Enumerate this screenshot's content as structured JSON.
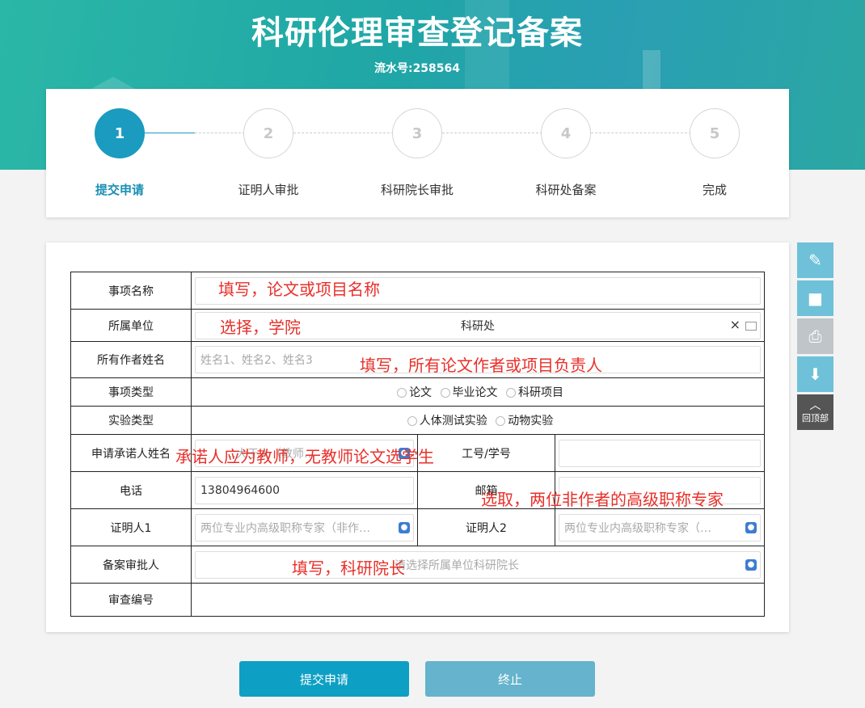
{
  "header": {
    "title": "科研伦理审查登记备案",
    "serial": "流水号:258564"
  },
  "steps": [
    {
      "num": "1",
      "label": "提交申请",
      "active": true
    },
    {
      "num": "2",
      "label": "证明人审批",
      "active": false
    },
    {
      "num": "3",
      "label": "科研院长审批",
      "active": false
    },
    {
      "num": "4",
      "label": "科研处备案",
      "active": false
    },
    {
      "num": "5",
      "label": "完成",
      "active": false
    }
  ],
  "form": {
    "item_name": {
      "label": "事项名称",
      "value": ""
    },
    "unit": {
      "label": "所属单位",
      "value": "科研处",
      "clear": "×"
    },
    "authors": {
      "label": "所有作者姓名",
      "placeholder": "姓名1、姓名2、姓名3"
    },
    "item_type": {
      "label": "事项类型",
      "options": [
        "论文",
        "毕业论文",
        "科研项目"
      ]
    },
    "exp_type": {
      "label": "实验类型",
      "options": [
        "人体测试实验",
        "动物实验"
      ]
    },
    "applicant": {
      "label": "申请承诺人姓名",
      "placeholder": "…大于人（教师…"
    },
    "staff_id": {
      "label": "工号/学号",
      "value": ""
    },
    "phone": {
      "label": "电话",
      "value": "13804964600"
    },
    "email": {
      "label": "邮箱",
      "value": ""
    },
    "witness1": {
      "label": "证明人1",
      "placeholder": "两位专业内高级职称专家（非作…"
    },
    "witness2": {
      "label": "证明人2",
      "placeholder": "两位专业内高级职称专家（…"
    },
    "approver": {
      "label": "备案审批人",
      "placeholder": "请选择所属单位科研院长"
    },
    "review_no": {
      "label": "审查编号",
      "value": ""
    }
  },
  "annotations": {
    "a1": "填写，论文或项目名称",
    "a2": "选择，学院",
    "a3": "填写，所有论文作者或项目负责人",
    "a4": "承诺人应为教师，无教师论文选学生",
    "a5": "选取，两位非作者的高级职称专家",
    "a6": "填写，科研院长"
  },
  "side_tools": {
    "top_label": "回顶部"
  },
  "buttons": {
    "submit": "提交申请",
    "stop": "终止"
  },
  "colors": {
    "accent": "#1a9bbf",
    "annotation": "#e8302a"
  }
}
